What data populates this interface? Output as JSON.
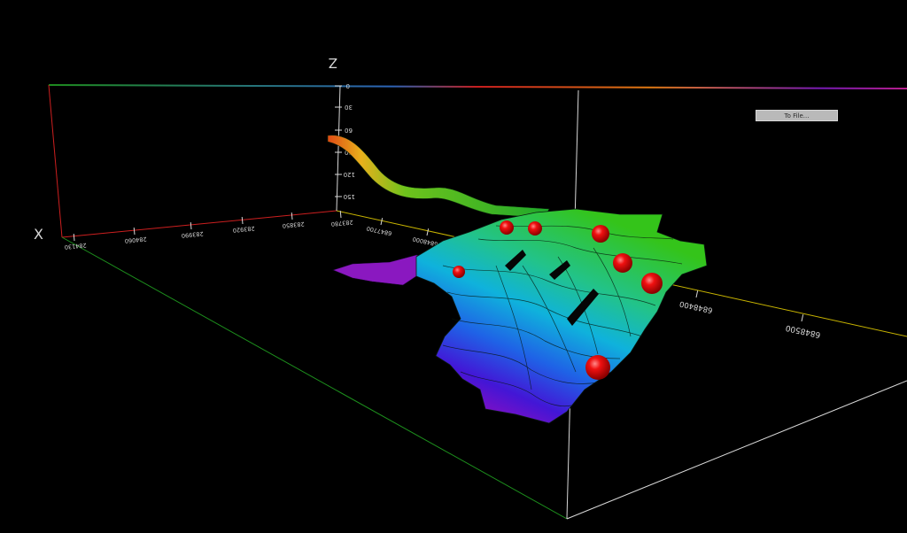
{
  "toolbar": {
    "to_file_label": "To File..."
  },
  "axes": {
    "z_label": "Z",
    "x_label": "X",
    "z_ticks": [
      "0",
      "30",
      "60",
      "90",
      "120",
      "150"
    ],
    "x_ticks": [
      "284130",
      "284060",
      "283990",
      "283920",
      "283850",
      "283780"
    ],
    "y_ticks": [
      "6847700",
      "6848000",
      "6848400",
      "6848500"
    ]
  },
  "markers": {
    "count": 7,
    "color": "#e8000a"
  },
  "colors": {
    "background": "#000000",
    "box_red": "#cc1f1f",
    "box_green": "#1d8f1d",
    "box_yellow": "#c8b400",
    "box_white": "#d8d8d8",
    "surface_top": "#2fb81e",
    "surface_bottom": "#6a10c8"
  }
}
